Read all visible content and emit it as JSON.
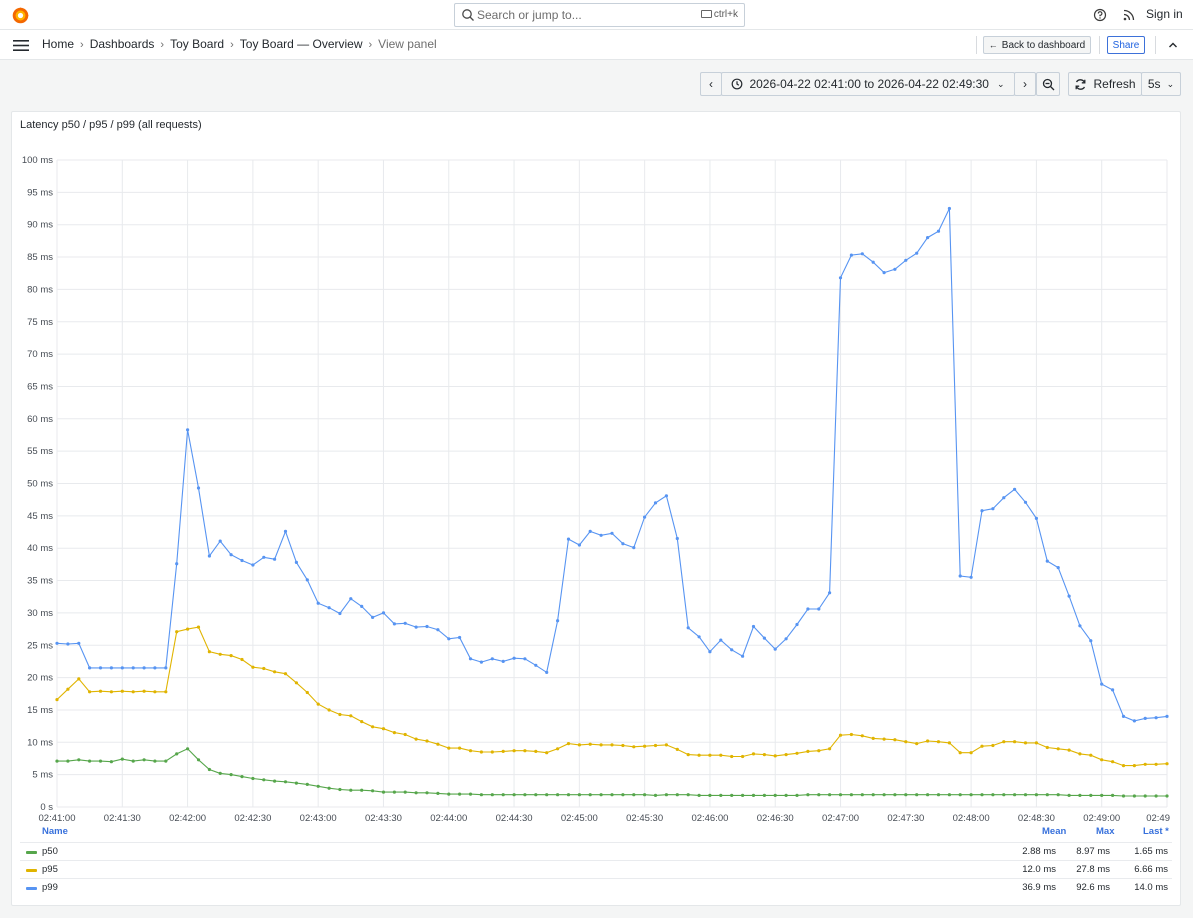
{
  "topbar": {
    "search_placeholder": "Search or jump to...",
    "search_shortcut": "ctrl+k",
    "signin_label": "Sign in"
  },
  "breadcrumb": [
    "Home",
    "Dashboards",
    "Toy Board",
    "Toy Board — Overview",
    "View panel"
  ],
  "actions": {
    "back_label": "Back to dashboard",
    "share_label": "Share"
  },
  "timepicker": {
    "range_label": "2026-04-22 02:41:00 to 2026-04-22 02:49:30",
    "refresh_label": "Refresh",
    "interval_label": "5s"
  },
  "panel": {
    "title": "Latency p50 / p95 / p99 (all requests)"
  },
  "colors": {
    "p50": "#56a64b",
    "p95": "#e0b400",
    "p99": "#5794f2",
    "accent": "#3871dc"
  },
  "chart_data": {
    "type": "line",
    "title": "Latency p50 / p95 / p99 (all requests)",
    "x_start": "02:41:00",
    "x_step_seconds": 5,
    "xticks": [
      "02:41:00",
      "02:41:30",
      "02:42:00",
      "02:42:30",
      "02:43:00",
      "02:43:30",
      "02:44:00",
      "02:44:30",
      "02:45:00",
      "02:45:30",
      "02:46:00",
      "02:46:30",
      "02:47:00",
      "02:47:30",
      "02:48:00",
      "02:48:30",
      "02:49:00",
      "02:49"
    ],
    "yticks": [
      "0 s",
      "5 ms",
      "10 ms",
      "15 ms",
      "20 ms",
      "25 ms",
      "30 ms",
      "35 ms",
      "40 ms",
      "45 ms",
      "50 ms",
      "55 ms",
      "60 ms",
      "65 ms",
      "70 ms",
      "75 ms",
      "80 ms",
      "85 ms",
      "90 ms",
      "95 ms",
      "100 ms"
    ],
    "ylim": [
      0,
      100
    ],
    "xlim_seconds": [
      0,
      510
    ],
    "unit": "ms",
    "grid": true,
    "legend_placement": "bottom",
    "series": [
      {
        "name": "p50",
        "values": [
          7.1,
          7.1,
          7.3,
          7.1,
          7.1,
          7.0,
          7.4,
          7.1,
          7.3,
          7.1,
          7.1,
          8.2,
          9.0,
          7.3,
          5.8,
          5.2,
          5.0,
          4.7,
          4.4,
          4.2,
          4.0,
          3.9,
          3.7,
          3.5,
          3.2,
          2.9,
          2.7,
          2.6,
          2.6,
          2.5,
          2.3,
          2.3,
          2.3,
          2.2,
          2.2,
          2.1,
          2.0,
          2.0,
          2.0,
          1.9,
          1.9,
          1.9,
          1.9,
          1.9,
          1.9,
          1.9,
          1.9,
          1.9,
          1.9,
          1.9,
          1.9,
          1.9,
          1.9,
          1.9,
          1.9,
          1.8,
          1.9,
          1.9,
          1.9,
          1.8,
          1.8,
          1.8,
          1.8,
          1.8,
          1.8,
          1.8,
          1.8,
          1.8,
          1.8,
          1.9,
          1.9,
          1.9,
          1.9,
          1.9,
          1.9,
          1.9,
          1.9,
          1.9,
          1.9,
          1.9,
          1.9,
          1.9,
          1.9,
          1.9,
          1.9,
          1.9,
          1.9,
          1.9,
          1.9,
          1.9,
          1.9,
          1.9,
          1.9,
          1.8,
          1.8,
          1.8,
          1.8,
          1.8,
          1.7,
          1.7,
          1.7,
          1.7,
          1.7
        ],
        "legend": {
          "mean": "2.88 ms",
          "max": "8.97 ms",
          "last": "1.65 ms"
        }
      },
      {
        "name": "p95",
        "values": [
          16.6,
          18.2,
          19.8,
          17.8,
          17.9,
          17.8,
          17.9,
          17.8,
          17.9,
          17.8,
          17.8,
          27.1,
          27.5,
          27.8,
          24.0,
          23.6,
          23.4,
          22.8,
          21.6,
          21.4,
          20.9,
          20.6,
          19.2,
          17.7,
          15.9,
          15.0,
          14.3,
          14.1,
          13.2,
          12.4,
          12.1,
          11.5,
          11.2,
          10.5,
          10.2,
          9.7,
          9.1,
          9.1,
          8.7,
          8.5,
          8.5,
          8.6,
          8.7,
          8.7,
          8.6,
          8.4,
          9.0,
          9.8,
          9.6,
          9.7,
          9.6,
          9.6,
          9.5,
          9.3,
          9.4,
          9.5,
          9.6,
          8.9,
          8.1,
          8.0,
          8.0,
          8.0,
          7.8,
          7.8,
          8.2,
          8.1,
          7.9,
          8.1,
          8.3,
          8.6,
          8.7,
          9.0,
          11.1,
          11.2,
          11.0,
          10.6,
          10.5,
          10.4,
          10.1,
          9.8,
          10.2,
          10.1,
          9.9,
          8.4,
          8.4,
          9.4,
          9.5,
          10.1,
          10.1,
          9.9,
          9.9,
          9.2,
          9.0,
          8.8,
          8.2,
          8.0,
          7.3,
          7.0,
          6.4,
          6.4,
          6.6,
          6.6,
          6.7
        ],
        "legend": {
          "mean": "12.0 ms",
          "max": "27.8 ms",
          "last": "6.66 ms"
        }
      },
      {
        "name": "p99",
        "values": [
          25.3,
          25.2,
          25.3,
          21.5,
          21.5,
          21.5,
          21.5,
          21.5,
          21.5,
          21.5,
          21.5,
          37.6,
          58.3,
          49.3,
          38.8,
          41.1,
          39.0,
          38.1,
          37.4,
          38.6,
          38.3,
          42.6,
          37.8,
          35.1,
          31.5,
          30.8,
          29.9,
          32.2,
          31.0,
          29.3,
          30.0,
          28.3,
          28.4,
          27.8,
          27.9,
          27.4,
          26.0,
          26.2,
          22.9,
          22.4,
          22.9,
          22.5,
          23.0,
          22.9,
          21.9,
          20.8,
          28.8,
          41.4,
          40.5,
          42.6,
          42.0,
          42.3,
          40.7,
          40.1,
          44.8,
          47.0,
          48.1,
          41.5,
          27.7,
          26.3,
          24.0,
          25.8,
          24.3,
          23.3,
          27.9,
          26.1,
          24.4,
          26.0,
          28.2,
          30.6,
          30.6,
          33.1,
          81.8,
          85.3,
          85.5,
          84.2,
          82.6,
          83.1,
          84.5,
          85.6,
          88.0,
          89.0,
          92.5,
          35.7,
          35.5,
          45.8,
          46.1,
          47.8,
          49.1,
          47.1,
          44.6,
          38.0,
          37.0,
          32.6,
          28.0,
          25.7,
          19.0,
          18.1,
          14.0,
          13.3,
          13.7,
          13.8,
          14.0
        ],
        "legend": {
          "mean": "36.9 ms",
          "max": "92.6 ms",
          "last": "14.0 ms"
        }
      }
    ],
    "legend_columns": [
      "Name",
      "Mean",
      "Max",
      "Last *"
    ]
  }
}
